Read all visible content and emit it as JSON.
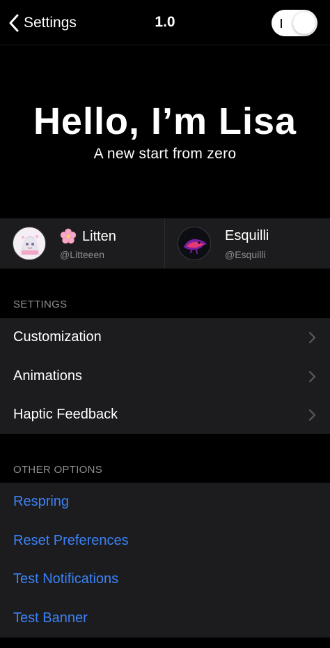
{
  "navbar": {
    "back_label": "Settings",
    "title": "1.0",
    "toggle_on": true
  },
  "hero": {
    "title": "Hello, I’m Lisa",
    "subtitle": "A new start from zero"
  },
  "credits": [
    {
      "name": "Litten",
      "handle": "@Litteeen",
      "icon": "cherry-blossom-icon"
    },
    {
      "name": "Esquilli",
      "handle": "@Esquilli",
      "icon": ""
    }
  ],
  "sections": {
    "settings": {
      "header": "SETTINGS",
      "items": [
        {
          "label": "Customization"
        },
        {
          "label": "Animations"
        },
        {
          "label": "Haptic Feedback"
        }
      ]
    },
    "other": {
      "header": "OTHER OPTIONS",
      "items": [
        {
          "label": "Respring"
        },
        {
          "label": "Reset Preferences"
        },
        {
          "label": "Test Notifications"
        },
        {
          "label": "Test Banner"
        }
      ]
    }
  },
  "colors": {
    "background": "#000000",
    "cell_background": "#1c1c1e",
    "link_blue": "#3b82f6",
    "secondary_text": "#8e8e93"
  }
}
